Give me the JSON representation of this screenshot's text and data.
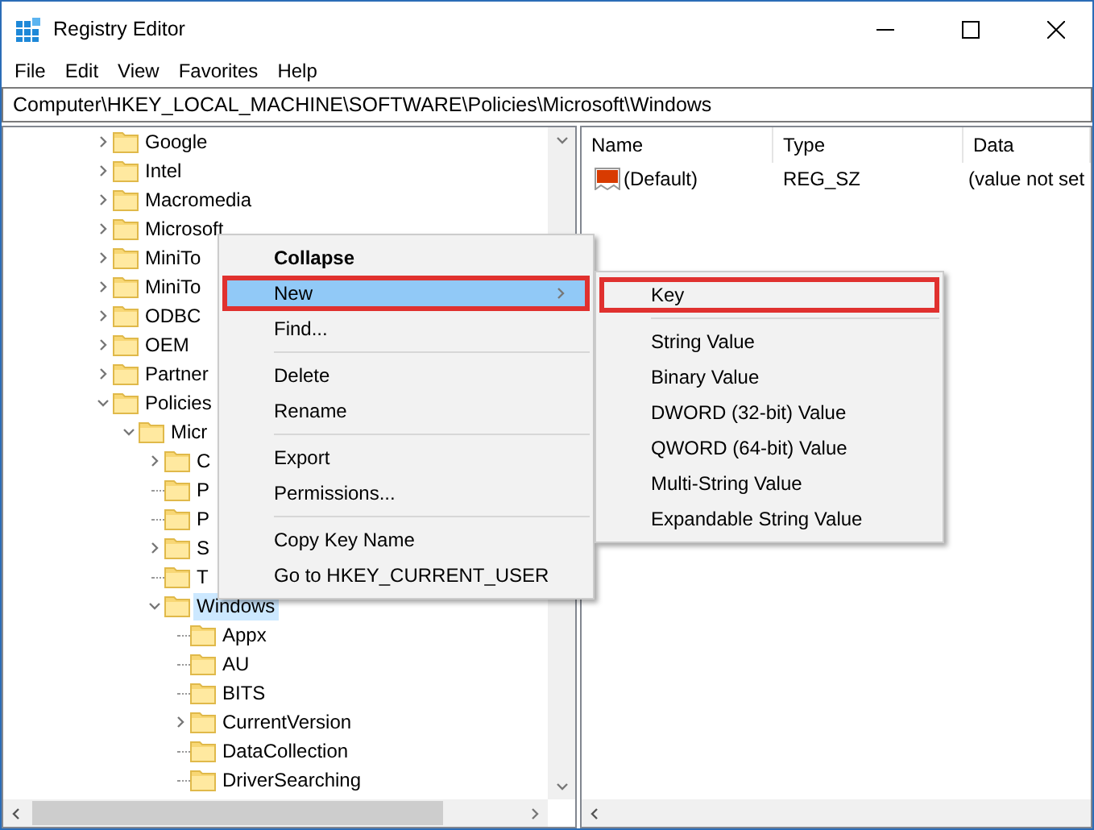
{
  "window": {
    "title": "Registry Editor"
  },
  "menu_bar": [
    "File",
    "Edit",
    "View",
    "Favorites",
    "Help"
  ],
  "address_bar": {
    "value": "Computer\\HKEY_LOCAL_MACHINE\\SOFTWARE\\Policies\\Microsoft\\Windows"
  },
  "tree": [
    {
      "label": "Google",
      "kind": "node",
      "expanded": false,
      "selected": false
    },
    {
      "label": "Intel",
      "kind": "node",
      "expanded": false,
      "selected": false
    },
    {
      "label": "Macromedia",
      "kind": "node",
      "expanded": false,
      "selected": false
    },
    {
      "label": "Microsoft",
      "kind": "node",
      "expanded": false,
      "selected": false
    },
    {
      "label": "MiniTo",
      "kind": "node",
      "expanded": false,
      "selected": false
    },
    {
      "label": "MiniTo",
      "kind": "node",
      "expanded": false,
      "selected": false
    },
    {
      "label": "ODBC",
      "kind": "node",
      "expanded": false,
      "selected": false
    },
    {
      "label": "OEM",
      "kind": "node",
      "expanded": false,
      "selected": false
    },
    {
      "label": "Partner",
      "kind": "node",
      "expanded": false,
      "selected": false
    },
    {
      "label": "Policies",
      "kind": "node",
      "expanded": true,
      "selected": false,
      "children": [
        {
          "label": "Micr",
          "kind": "node",
          "expanded": true,
          "selected": false,
          "children": [
            {
              "label": "C",
              "kind": "node",
              "expanded": false,
              "selected": false
            },
            {
              "label": "P",
              "kind": "leaf",
              "selected": false
            },
            {
              "label": "P",
              "kind": "leaf",
              "selected": false
            },
            {
              "label": "S",
              "kind": "node",
              "expanded": false,
              "selected": false
            },
            {
              "label": "T",
              "kind": "leaf",
              "selected": false
            },
            {
              "label": "Windows",
              "kind": "node",
              "expanded": true,
              "selected": true,
              "children": [
                {
                  "label": "Appx",
                  "kind": "leaf",
                  "selected": false
                },
                {
                  "label": "AU",
                  "kind": "leaf",
                  "selected": false
                },
                {
                  "label": "BITS",
                  "kind": "leaf",
                  "selected": false
                },
                {
                  "label": "CurrentVersion",
                  "kind": "node",
                  "expanded": false,
                  "selected": false
                },
                {
                  "label": "DataCollection",
                  "kind": "leaf",
                  "selected": false
                },
                {
                  "label": "DriverSearching",
                  "kind": "leaf",
                  "selected": false
                }
              ]
            }
          ]
        }
      ]
    }
  ],
  "values_table": {
    "columns": [
      "Name",
      "Type",
      "Data"
    ],
    "rows": [
      {
        "name": "(Default)",
        "type": "REG_SZ",
        "data": "(value not set"
      }
    ]
  },
  "context_menu": [
    [
      {
        "label": "Collapse",
        "default": true,
        "selected": false,
        "outlined": false,
        "submenu": false
      },
      {
        "label": "New",
        "default": false,
        "selected": true,
        "outlined": true,
        "submenu": true
      },
      {
        "label": "Find...",
        "default": false,
        "selected": false,
        "outlined": false,
        "submenu": false
      }
    ],
    [
      {
        "label": "Delete",
        "default": false,
        "selected": false,
        "outlined": false,
        "submenu": false
      },
      {
        "label": "Rename",
        "default": false,
        "selected": false,
        "outlined": false,
        "submenu": false
      }
    ],
    [
      {
        "label": "Export",
        "default": false,
        "selected": false,
        "outlined": false,
        "submenu": false
      },
      {
        "label": "Permissions...",
        "default": false,
        "selected": false,
        "outlined": false,
        "submenu": false
      }
    ],
    [
      {
        "label": "Copy Key Name",
        "default": false,
        "selected": false,
        "outlined": false,
        "submenu": false
      },
      {
        "label": "Go to HKEY_CURRENT_USER",
        "default": false,
        "selected": false,
        "outlined": false,
        "submenu": false
      }
    ]
  ],
  "submenu": [
    [
      {
        "label": "Key",
        "outlined": true
      }
    ],
    [
      {
        "label": "String Value",
        "outlined": false
      },
      {
        "label": "Binary Value",
        "outlined": false
      },
      {
        "label": "DWORD (32-bit) Value",
        "outlined": false
      },
      {
        "label": "QWORD (64-bit) Value",
        "outlined": false
      },
      {
        "label": "Multi-String Value",
        "outlined": false
      },
      {
        "label": "Expandable String Value",
        "outlined": false
      }
    ]
  ]
}
